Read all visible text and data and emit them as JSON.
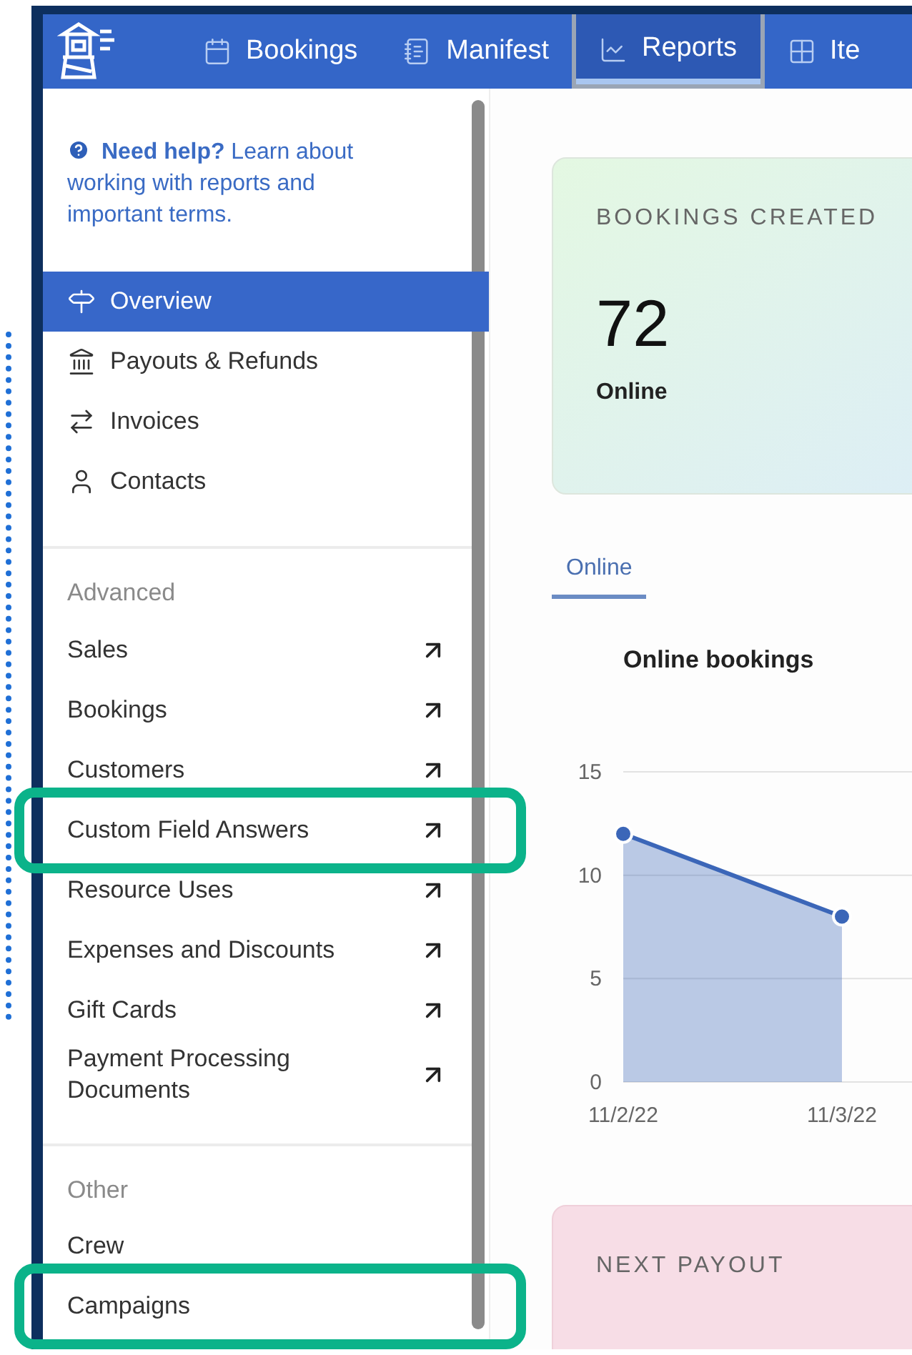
{
  "nav": {
    "tabs": [
      {
        "label": "Bookings",
        "selected": false
      },
      {
        "label": "Manifest",
        "selected": false
      },
      {
        "label": "Reports",
        "selected": true
      },
      {
        "label": "Ite",
        "selected": false
      }
    ]
  },
  "sidebar": {
    "help": "**Need help?** Learn about working with reports and important terms.",
    "items": [
      {
        "label": "Overview",
        "selected": true
      },
      {
        "label": "Payouts & Refunds",
        "selected": false
      },
      {
        "label": "Invoices",
        "selected": false
      },
      {
        "label": "Contacts",
        "selected": false
      }
    ],
    "sections": [
      {
        "heading": "Advanced",
        "items": [
          {
            "label": "Sales",
            "external": true,
            "highlighted": false
          },
          {
            "label": "Bookings",
            "external": true,
            "highlighted": false
          },
          {
            "label": "Customers",
            "external": true,
            "highlighted": false
          },
          {
            "label": "Custom Field Answers",
            "external": true,
            "highlighted": true
          },
          {
            "label": "Resource Uses",
            "external": true,
            "highlighted": false
          },
          {
            "label": "Expenses and Discounts",
            "external": true,
            "highlighted": false
          },
          {
            "label": "Gift Cards",
            "external": true,
            "highlighted": false
          },
          {
            "label": "Payment Processing Documents",
            "external": true,
            "highlighted": false
          }
        ]
      },
      {
        "heading": "Other",
        "items": [
          {
            "label": "Crew",
            "external": false,
            "highlighted": false
          },
          {
            "label": "Campaigns",
            "external": false,
            "highlighted": true
          }
        ]
      }
    ]
  },
  "main": {
    "bookings_card": {
      "title": "BOOKINGS CREATED",
      "value": "72",
      "caption": "Online"
    },
    "tabs": [
      {
        "label": "Online",
        "selected": true
      }
    ],
    "chart": {
      "title": "Online bookings",
      "chart_data": {
        "type": "area",
        "categories": [
          "11/2/22",
          "11/3/22"
        ],
        "series": [
          {
            "color": "#3b66b8",
            "values": [
              12,
              8
            ]
          }
        ],
        "ylim": [
          0,
          15
        ],
        "yticks": [
          0,
          5,
          10,
          15
        ]
      }
    },
    "payout_card": {
      "title": "NEXT PAYOUT"
    }
  }
}
